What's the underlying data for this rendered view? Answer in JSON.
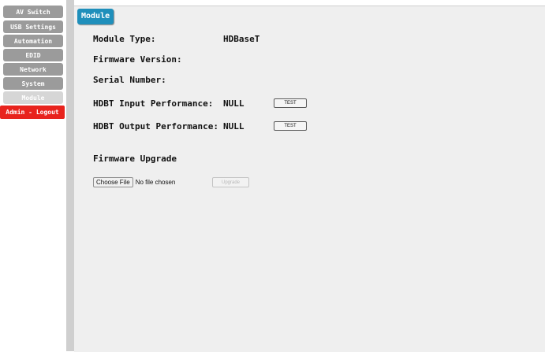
{
  "sidebar": {
    "items": [
      {
        "label": "AV Switch"
      },
      {
        "label": "USB Settings"
      },
      {
        "label": "Automation"
      },
      {
        "label": "EDID"
      },
      {
        "label": "Network"
      },
      {
        "label": "System"
      },
      {
        "label": "Module"
      },
      {
        "label": "Admin - Logout"
      }
    ],
    "active_item": "Module"
  },
  "main": {
    "tab_label": "Module",
    "module_type_label": "Module Type:",
    "module_type_value": "HDBaseT",
    "firmware_version_label": "Firmware Version:",
    "serial_number_label": "Serial Number:",
    "hdbt_input_label": "HDBT Input Performance:",
    "hdbt_input_value": "NULL",
    "hdbt_output_label": "HDBT Output Performance:",
    "hdbt_output_value": "NULL",
    "test_label": "TEST",
    "firmware_upgrade_label": "Firmware Upgrade",
    "choose_file_label": "Choose File",
    "no_file_text": "No file chosen",
    "upgrade_label": "Upgrade"
  },
  "colors": {
    "nav_gray": "#9b9b9b",
    "nav_active": "#d6d6d6",
    "logout_red": "#e8231d",
    "tab_blue": "#1f8fbb",
    "panel_bg": "#efefef"
  }
}
